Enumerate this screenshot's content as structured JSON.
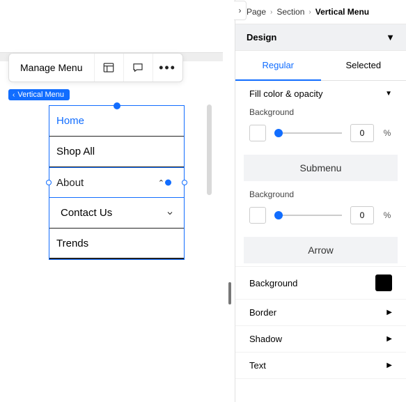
{
  "toolbar": {
    "manage_label": "Manage Menu"
  },
  "badge": {
    "label": "Vertical Menu"
  },
  "menu": {
    "items": [
      "Home",
      "Shop All",
      "About",
      "Contact Us",
      "Trends"
    ]
  },
  "breadcrumbs": [
    "Page",
    "Section",
    "Vertical Menu"
  ],
  "design_section": {
    "title": "Design",
    "tabs": {
      "regular": "Regular",
      "selected": "Selected"
    },
    "fill_color_label": "Fill color & opacity",
    "background_label": "Background",
    "submenu_label": "Submenu",
    "arrow_label": "Arrow",
    "arrow_bg_label": "Background",
    "arrow_bg_color": "#000000",
    "bg_value_main": 0,
    "bg_value_sub": 0,
    "rows": {
      "border": "Border",
      "shadow": "Shadow",
      "text": "Text"
    },
    "unit": "%"
  }
}
